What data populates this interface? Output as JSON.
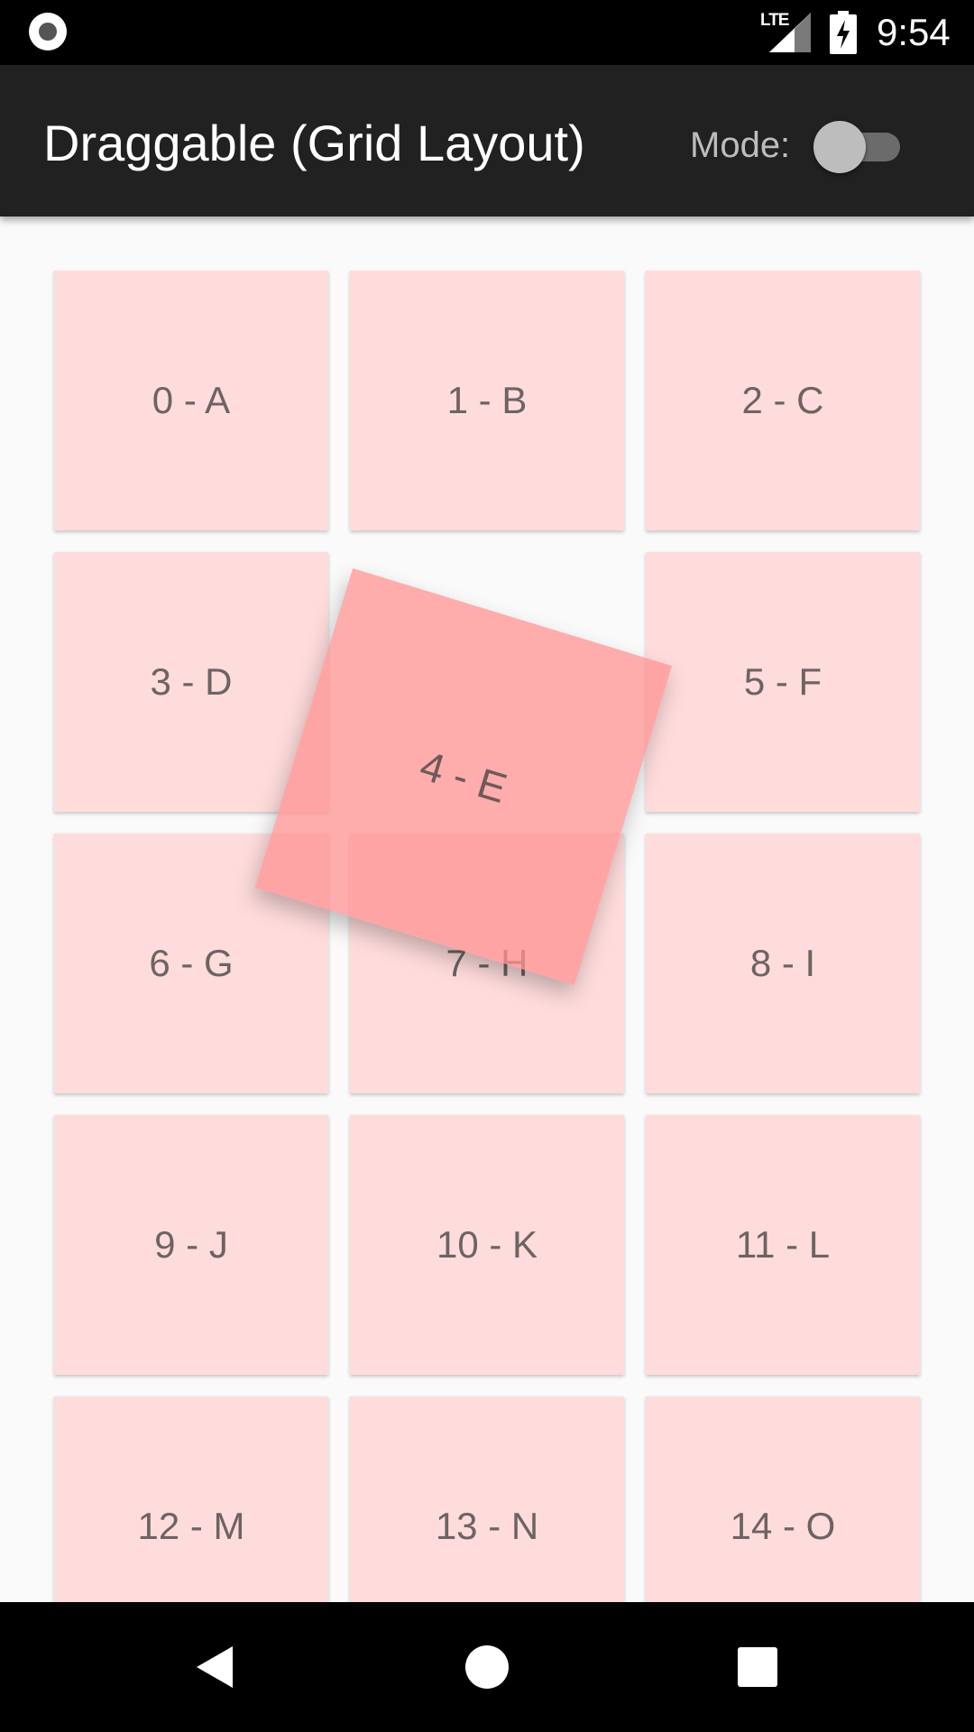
{
  "status_bar": {
    "left_icon": "record-icon",
    "network": "LTE",
    "signal_icon": "cell-signal-icon",
    "battery_icon": "battery-charging-icon",
    "time": "9:54"
  },
  "app_bar": {
    "title": "Draggable (Grid Layout)",
    "mode_label": "Mode:",
    "mode_switch_on": false
  },
  "grid": {
    "tiles": [
      {
        "label": "0 - A"
      },
      {
        "label": "1 - B"
      },
      {
        "label": "2 - C"
      },
      {
        "label": "3 - D"
      },
      {
        "label": "5 - F"
      },
      {
        "label": "6 - G"
      },
      {
        "label": "7 - H"
      },
      {
        "label": "8 - I"
      },
      {
        "label": "9 - J"
      },
      {
        "label": "10 - K"
      },
      {
        "label": "11 - L"
      },
      {
        "label": "12 - M"
      },
      {
        "label": "13 - N"
      },
      {
        "label": "14 - O"
      }
    ],
    "dragging_tile": {
      "label": "4 - E"
    }
  },
  "colors": {
    "tile": "#ffdcdc",
    "dragging_tile": "#ff9191",
    "app_bar": "#212121",
    "background": "#fafafa"
  },
  "nav_bar": {
    "back_icon": "back-triangle-icon",
    "home_icon": "home-circle-icon",
    "recents_icon": "recents-square-icon"
  }
}
